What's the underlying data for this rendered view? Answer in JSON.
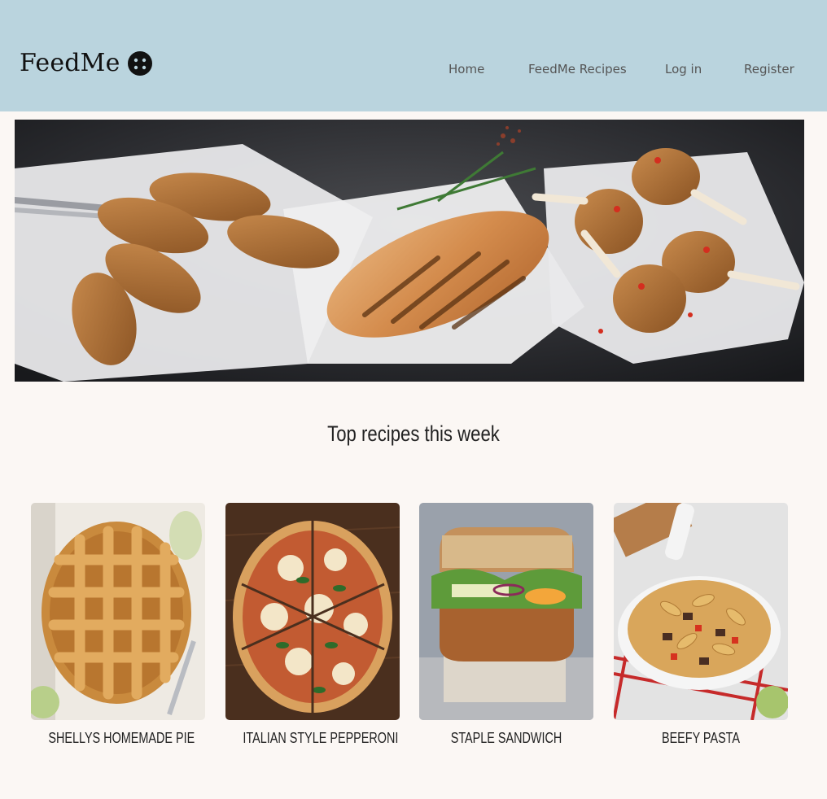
{
  "header": {
    "brand": "FeedMe",
    "brand_icon": "smiley-face-icon",
    "background": "#bad4de"
  },
  "nav": {
    "items": [
      {
        "label": "Home"
      },
      {
        "label": "FeedMe Recipes"
      },
      {
        "label": "Log in"
      },
      {
        "label": "Register"
      }
    ]
  },
  "hero": {
    "image": "grilled-chicken-banner-image"
  },
  "section": {
    "title": "Top recipes this week"
  },
  "recipes": [
    {
      "title": "SHELLYS HOMEMADE PIE",
      "image": "lattice-pie-image"
    },
    {
      "title": "ITALIAN STYLE PEPPERONI",
      "image": "pizza-image"
    },
    {
      "title": "STAPLE SANDWICH",
      "image": "sandwich-image"
    },
    {
      "title": "BEEFY PASTA",
      "image": "pasta-pan-image"
    }
  ],
  "colors": {
    "page_background": "#fbf7f4",
    "header_background": "#bad4de"
  }
}
